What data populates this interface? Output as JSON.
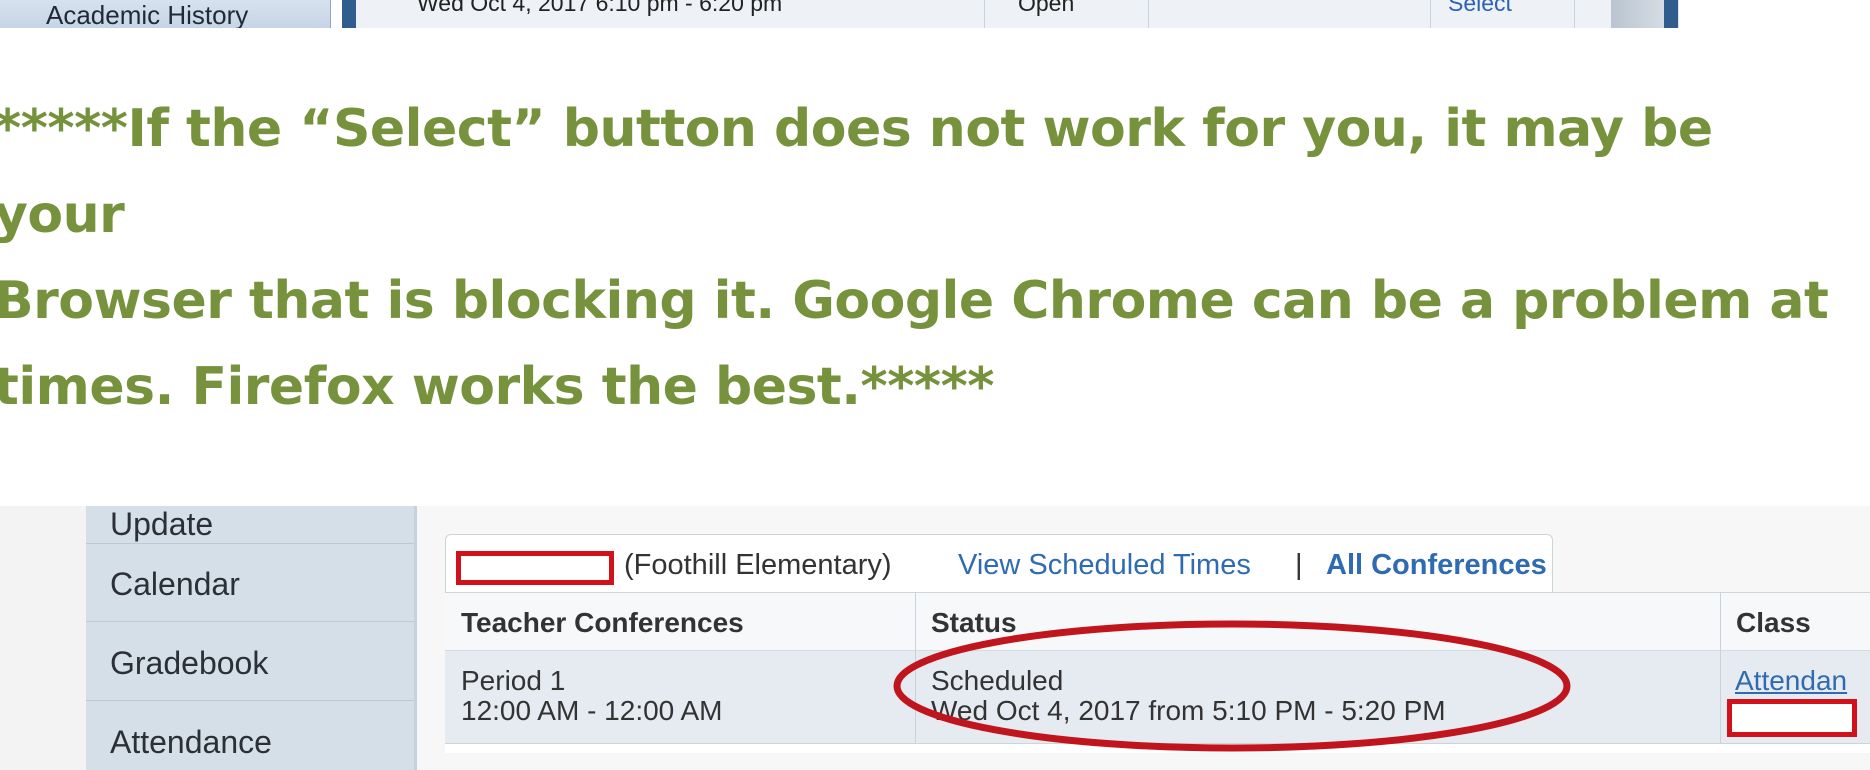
{
  "top_strip": {
    "sidebar_item": "Academic History",
    "row_time": "Wed Oct 4, 2017 6:10 pm - 6:20 pm",
    "row_status": "Open",
    "row_action": "Select"
  },
  "note": {
    "text": "*****If the “Select” button does not work for you, it may be your\nBrowser that is blocking it.  Google Chrome can be a problem at\ntimes.  Firefox works the best.*****",
    "color": "#76923c"
  },
  "sidebar": {
    "items": [
      {
        "label": "Update"
      },
      {
        "label": "Calendar"
      },
      {
        "label": "Gradebook"
      },
      {
        "label": "Attendance"
      }
    ]
  },
  "tabs": {
    "school": "(Foothill Elementary)",
    "view_scheduled": "View Scheduled Times",
    "separator": "|",
    "all_conferences": "All Conferences"
  },
  "table": {
    "headers": [
      "Teacher Conferences",
      "Status",
      "Class"
    ],
    "row": {
      "period": "Period 1",
      "period_time": "12:00 AM - 12:00 AM",
      "status": "Scheduled",
      "status_time": "Wed Oct 4, 2017 from 5:10 PM - 5:20 PM",
      "class_link": "Attendan"
    }
  },
  "colors": {
    "annotation_red": "#d1121b",
    "link_blue": "#2f6bb0",
    "nav_bg": "#d5dfe8"
  }
}
